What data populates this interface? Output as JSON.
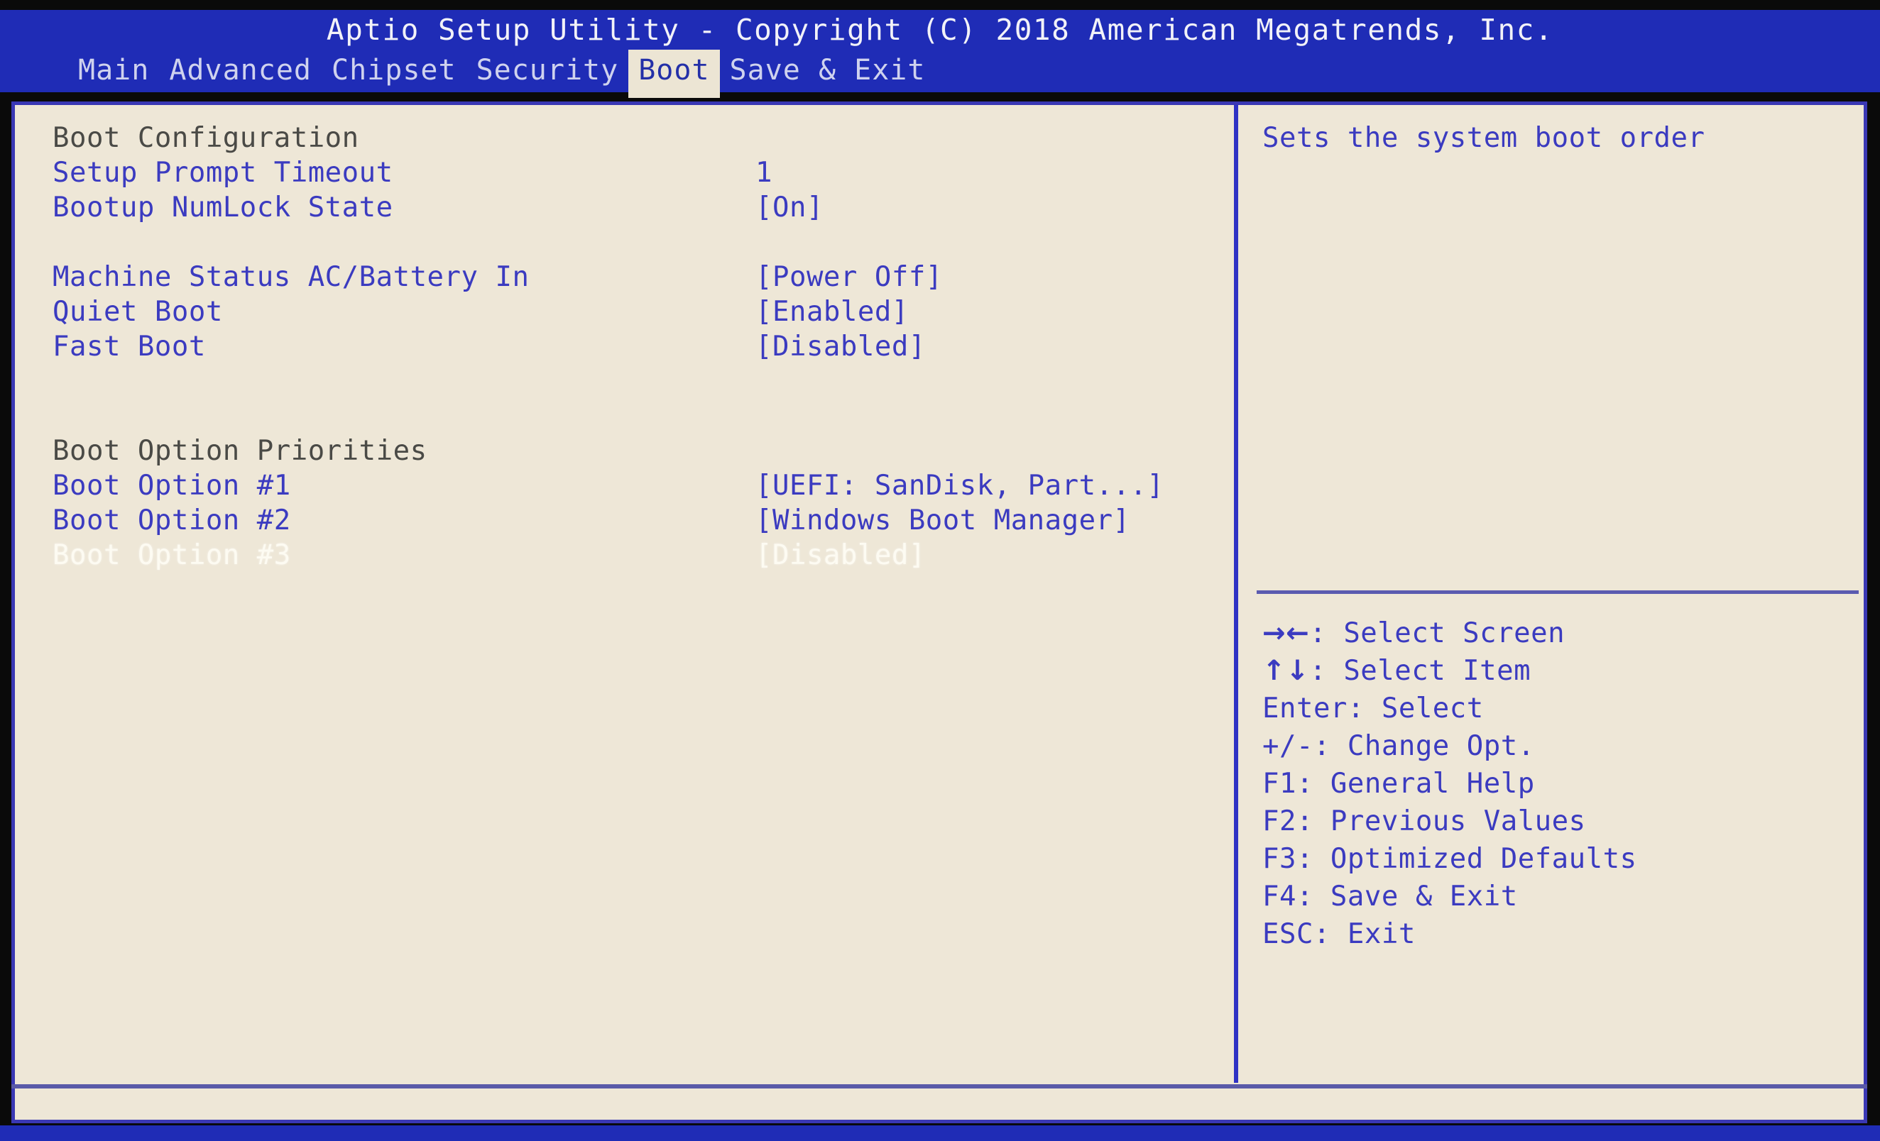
{
  "header": {
    "title": "Aptio Setup Utility - Copyright (C) 2018 American Megatrends, Inc.",
    "tabs": [
      {
        "label": "Main",
        "active": false
      },
      {
        "label": "Advanced",
        "active": false
      },
      {
        "label": "Chipset",
        "active": false
      },
      {
        "label": "Security",
        "active": false
      },
      {
        "label": "Boot",
        "active": true
      },
      {
        "label": "Save & Exit",
        "active": false
      }
    ]
  },
  "settings": {
    "rows": [
      {
        "label": "Boot Configuration",
        "value": "",
        "type": "heading"
      },
      {
        "label": "Setup Prompt Timeout",
        "value": "1",
        "type": "item"
      },
      {
        "label": "Bootup NumLock State",
        "value": "[On]",
        "type": "item"
      },
      {
        "label": "",
        "value": "",
        "type": "spacer"
      },
      {
        "label": "Machine Status AC/Battery In",
        "value": "[Power Off]",
        "type": "item"
      },
      {
        "label": "Quiet Boot",
        "value": "[Enabled]",
        "type": "item"
      },
      {
        "label": "Fast Boot",
        "value": "[Disabled]",
        "type": "item"
      },
      {
        "label": "",
        "value": "",
        "type": "spacer"
      },
      {
        "label": "",
        "value": "",
        "type": "spacer"
      },
      {
        "label": "Boot Option Priorities",
        "value": "",
        "type": "heading"
      },
      {
        "label": "Boot Option #1",
        "value": "[UEFI: SanDisk, Part...]",
        "type": "item"
      },
      {
        "label": "Boot Option #2",
        "value": "[Windows Boot Manager]",
        "type": "item"
      },
      {
        "label": "Boot Option #3",
        "value": "[Disabled]",
        "type": "selected"
      }
    ]
  },
  "help": {
    "description": "Sets the system boot order",
    "keys": [
      {
        "glyph": "→←",
        "text": ": Select Screen"
      },
      {
        "glyph": "↑↓",
        "text": ": Select Item"
      },
      {
        "glyph": "",
        "text": "Enter: Select"
      },
      {
        "glyph": "",
        "text": "+/-: Change Opt."
      },
      {
        "glyph": "",
        "text": "F1: General Help"
      },
      {
        "glyph": "",
        "text": "F2: Previous Values"
      },
      {
        "glyph": "",
        "text": "F3: Optimized Defaults"
      },
      {
        "glyph": "",
        "text": "F4: Save & Exit"
      },
      {
        "glyph": "",
        "text": "ESC: Exit"
      }
    ]
  },
  "colors": {
    "header_blue": "#1f2cb6",
    "panel_cream": "#eee7d7",
    "text_blue": "#3b3bc0",
    "heading_gray": "#4a4a46",
    "selected_white": "#fdfbf2",
    "border_blue": "#3a38b4"
  }
}
